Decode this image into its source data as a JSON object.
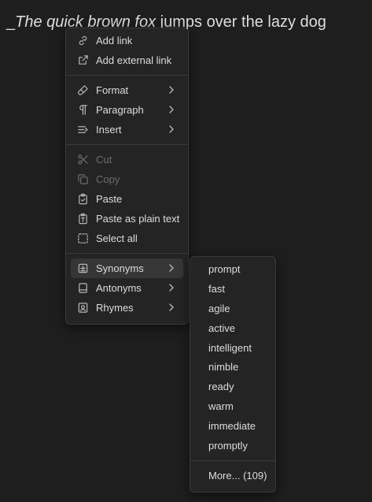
{
  "editor": {
    "leading": "_",
    "italic_text": "The quick brown fox ",
    "rest_text": " jumps over the lazy dog"
  },
  "context_menu": {
    "groups": [
      [
        {
          "label": "Add link",
          "icon": "link-icon"
        },
        {
          "label": "Add external link",
          "icon": "external-link-icon"
        }
      ],
      [
        {
          "label": "Format",
          "icon": "paintbrush-icon",
          "submenu": true
        },
        {
          "label": "Paragraph",
          "icon": "pilcrow-icon",
          "submenu": true
        },
        {
          "label": "Insert",
          "icon": "list-insert-icon",
          "submenu": true
        }
      ],
      [
        {
          "label": "Cut",
          "icon": "scissors-icon",
          "disabled": true
        },
        {
          "label": "Copy",
          "icon": "copy-icon",
          "disabled": true
        },
        {
          "label": "Paste",
          "icon": "clipboard-check-icon"
        },
        {
          "label": "Paste as plain text",
          "icon": "clipboard-type-icon"
        },
        {
          "label": "Select all",
          "icon": "select-all-icon"
        }
      ],
      [
        {
          "label": "Synonyms",
          "icon": "plus-square-icon",
          "submenu": true,
          "active": true
        },
        {
          "label": "Antonyms",
          "icon": "book-icon",
          "submenu": true
        },
        {
          "label": "Rhymes",
          "icon": "contact-icon",
          "submenu": true
        }
      ]
    ]
  },
  "synonyms_menu": {
    "items": [
      "prompt",
      "fast",
      "agile",
      "active",
      "intelligent",
      "nimble",
      "ready",
      "warm",
      "immediate",
      "promptly"
    ],
    "more_label": "More... (109)"
  }
}
